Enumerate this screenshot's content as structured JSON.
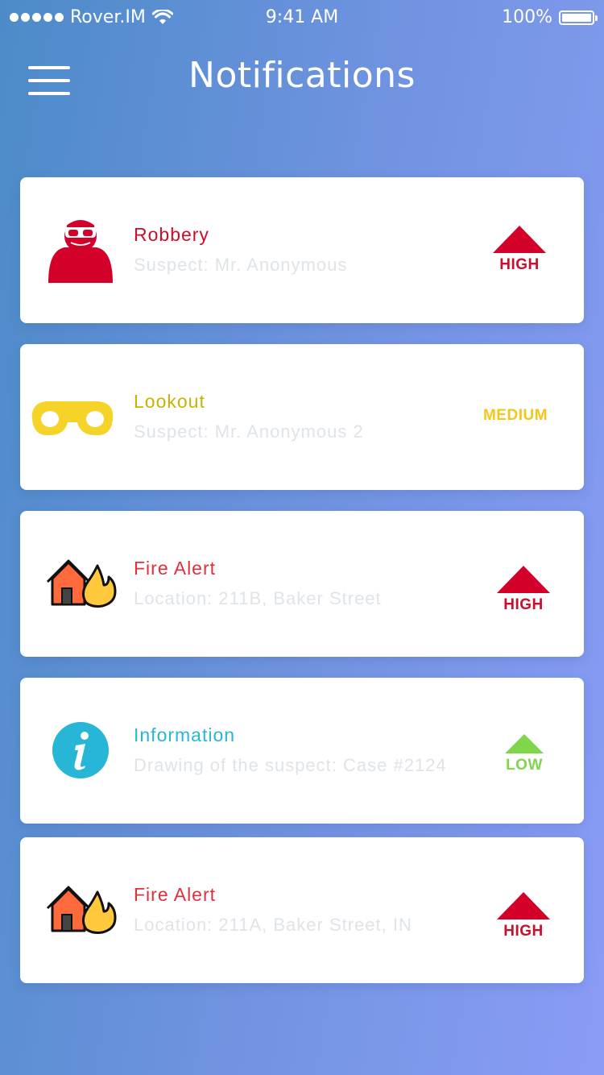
{
  "status_bar": {
    "carrier": "Rover.IM",
    "time": "9:41 AM",
    "battery": "100%"
  },
  "header": {
    "title": "Notifications",
    "menu_icon": "hamburger-menu-icon"
  },
  "colors": {
    "high": "#d3002a",
    "medium": "#f5d328",
    "low": "#7fd64b",
    "info": "#27b6d6",
    "subtitle": "#dfe3ea"
  },
  "notifications": [
    {
      "title": "Robbery",
      "subtitle": "Suspect: Mr. Anonymous",
      "priority": "HIGH",
      "icon": "robber-icon",
      "title_color": "#c8102e"
    },
    {
      "title": "Lookout",
      "subtitle": "Suspect: Mr. Anonymous 2",
      "priority": "MEDIUM",
      "icon": "binoculars-icon",
      "title_color": "#c8b400"
    },
    {
      "title": "Fire Alert",
      "subtitle": "Location: 211B, Baker Street",
      "priority": "HIGH",
      "icon": "house-fire-icon",
      "title_color": "#e0303b"
    },
    {
      "title": "Information",
      "subtitle": "Drawing of the suspect: Case #2124",
      "priority": "LOW",
      "icon": "info-icon",
      "title_color": "#27b6d6"
    },
    {
      "title": "Fire Alert",
      "subtitle": "Location: 211A, Baker Street, IN",
      "priority": "HIGH",
      "icon": "house-fire-icon",
      "title_color": "#e0303b"
    }
  ]
}
